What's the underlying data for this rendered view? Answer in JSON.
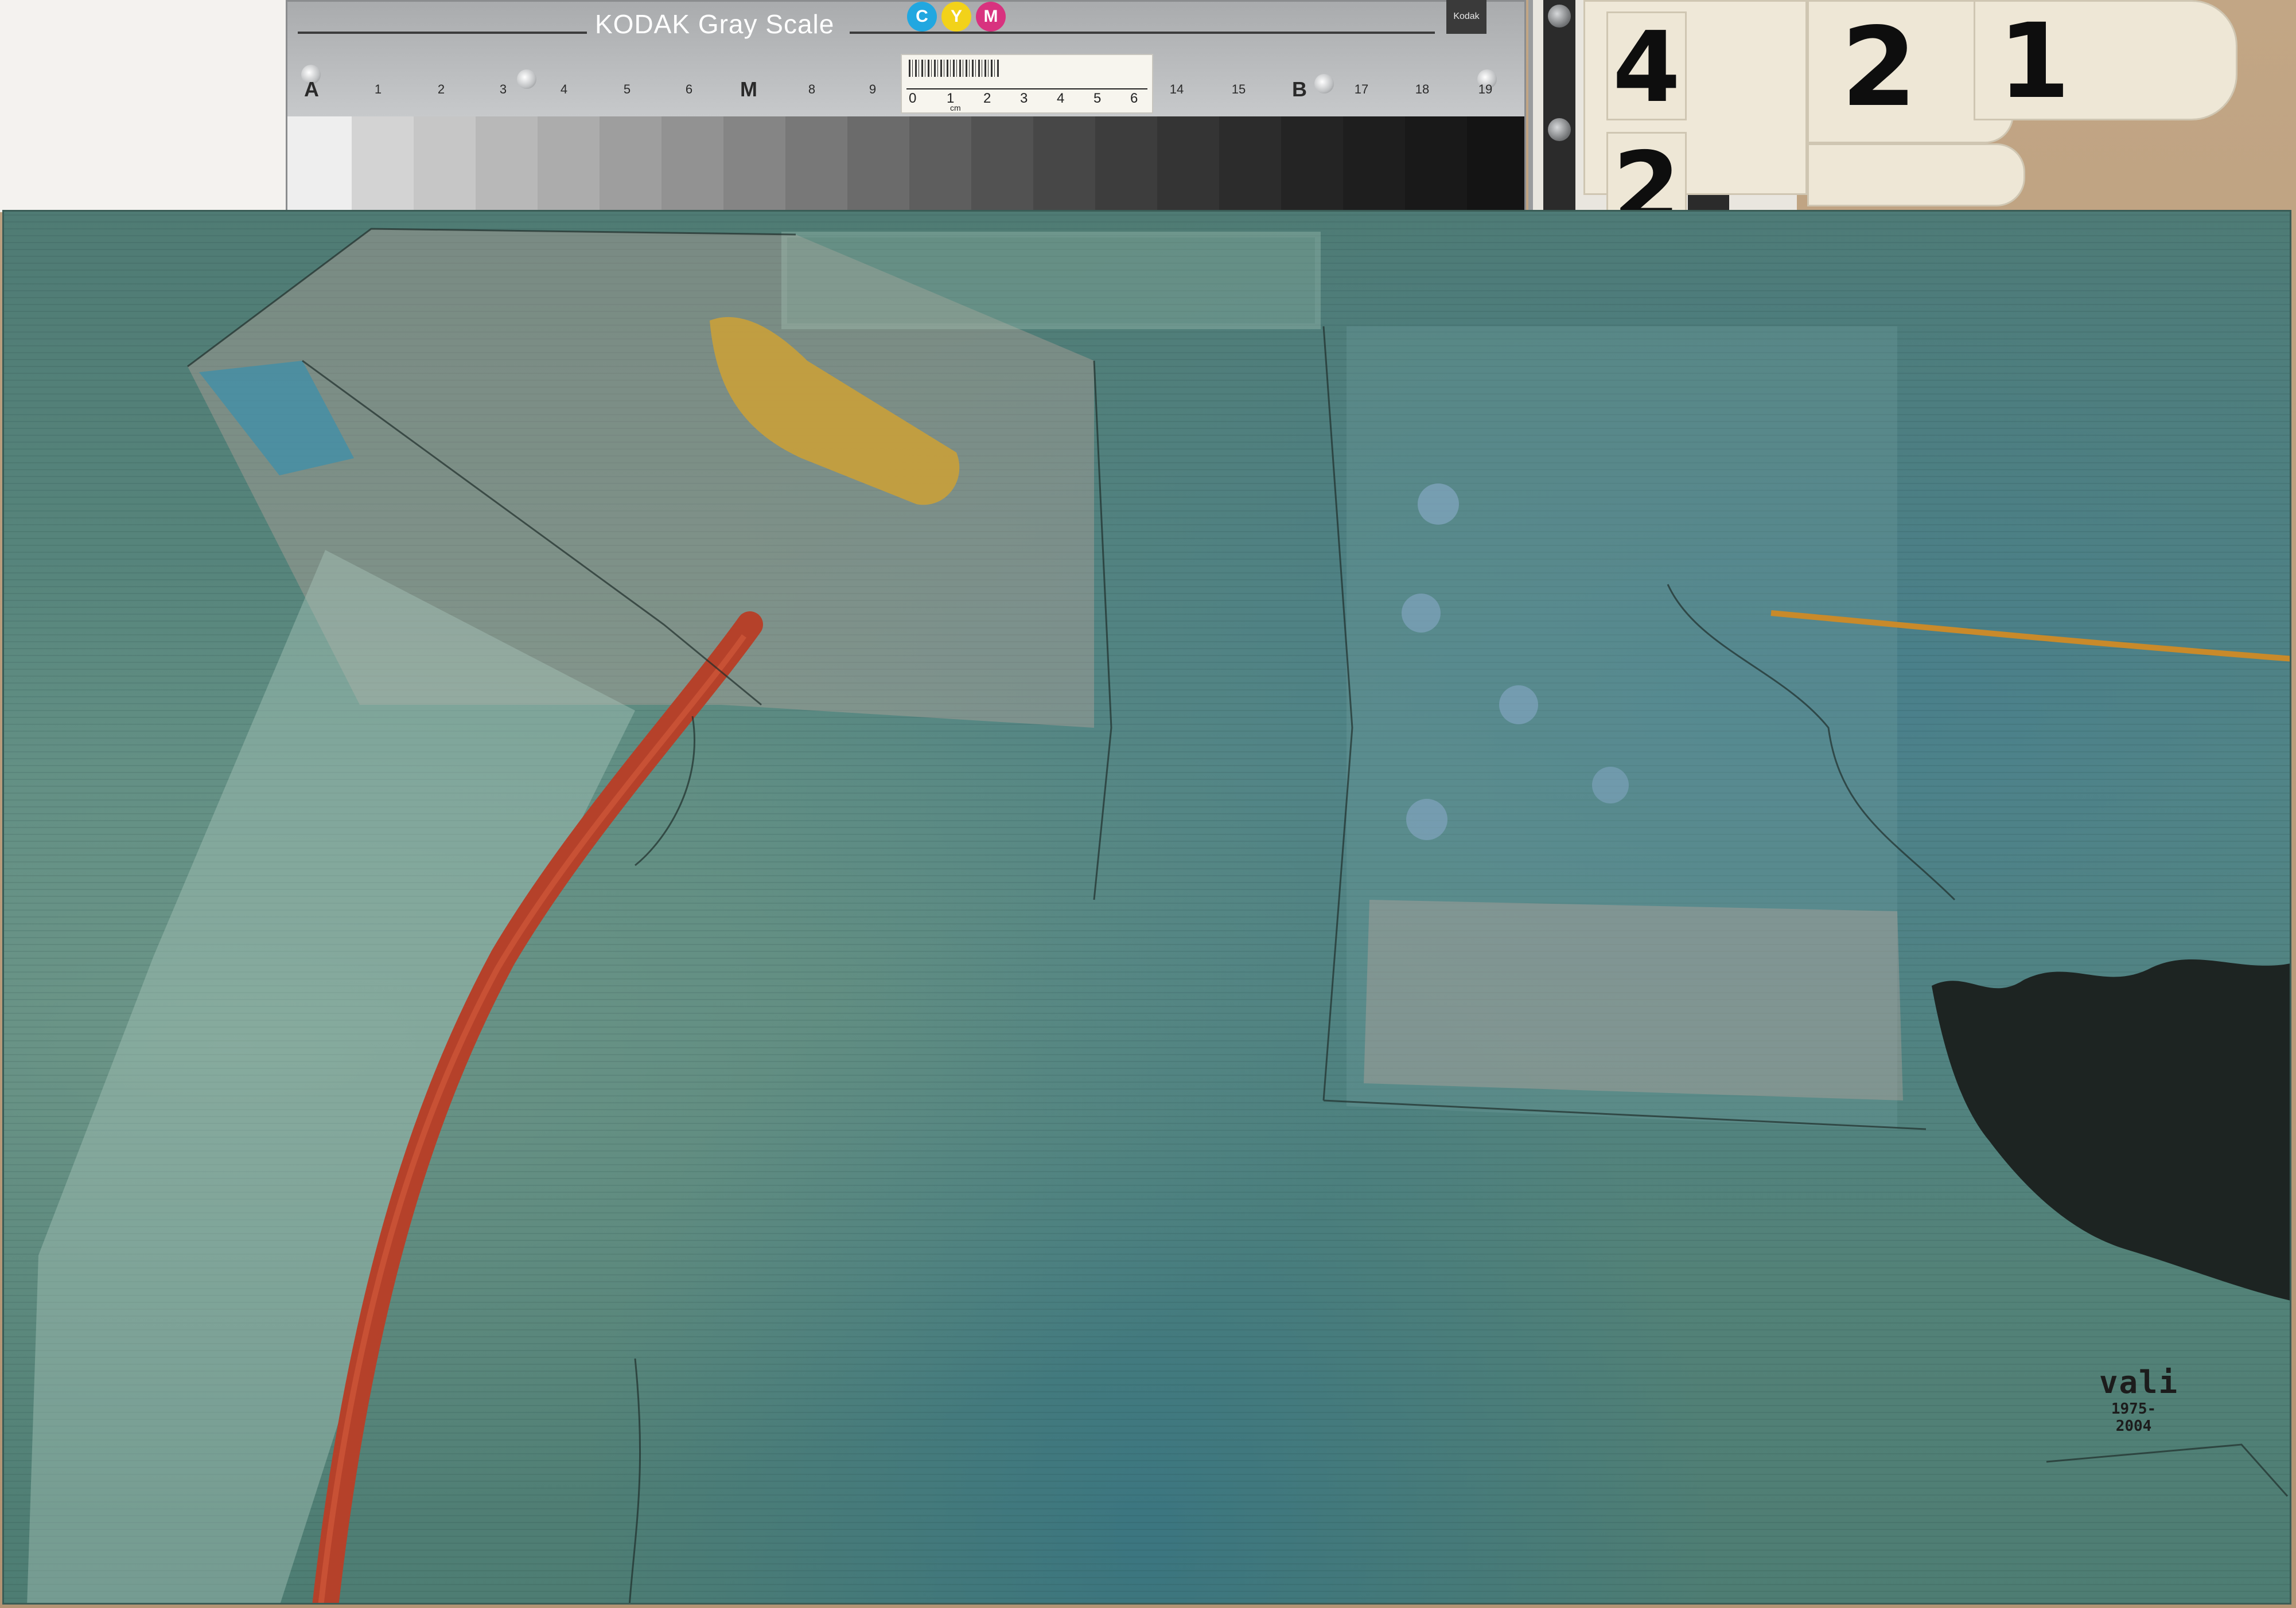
{
  "color_card": {
    "title": "KODAK Gray Scale",
    "cmy": [
      "C",
      "Y",
      "M"
    ],
    "cmy_colors": [
      "#21a7e0",
      "#f2d21a",
      "#d8327f"
    ],
    "logo_text": "Kodak",
    "scale_labels": [
      "A",
      "1",
      "2",
      "3",
      "4",
      "5",
      "6",
      "M",
      "8",
      "9",
      "14",
      "15",
      "B",
      "17",
      "18",
      "19"
    ]
  },
  "ruler": {
    "numbers": [
      "0",
      "1",
      "2",
      "3",
      "4",
      "5",
      "6"
    ],
    "unit": "cm"
  },
  "tags": {
    "top_row": [
      "2",
      "1"
    ],
    "left_column": [
      "4",
      "2"
    ]
  },
  "painting": {
    "signature_name": "vali",
    "signature_dates": "1975-2004",
    "palette": {
      "ground": "#56847a",
      "red_stroke": "#b5412a",
      "ochre_patch": "#c9a03a",
      "blue_patch": "#3e8fa9",
      "pink_wash": "#c9a8a0",
      "black_blot": "#1d2422",
      "orange_line": "#c98a2a"
    }
  }
}
